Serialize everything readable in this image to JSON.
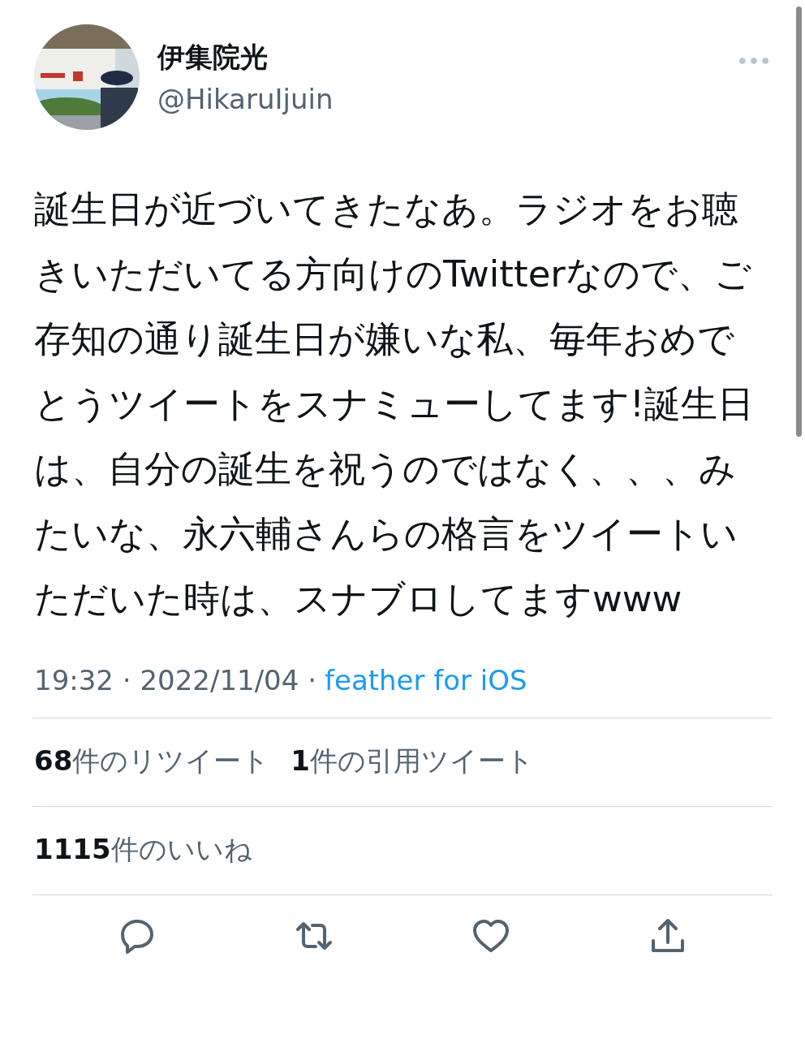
{
  "author": {
    "name": "伊集院光",
    "handle": "@HikaruIjuin"
  },
  "text": "誕生日が近づいてきたなあ。ラジオをお聴きいただいてる方向けのTwitterなので、ご存知の通り誕生日が嫌いな私、毎年おめでとうツイートをスナミューしてます!誕生日は、自分の誕生を祝うのではなく、、、みたいな、永六輔さんらの格言をツイートいただいた時は、スナブロしてますwww",
  "meta": {
    "time": "19:32",
    "separator": "·",
    "date": "2022/11/04",
    "source": "feather for iOS"
  },
  "stats": [
    {
      "count": "68",
      "label": "件のリツイート"
    },
    {
      "count": "1",
      "label": "件の引用ツイート"
    }
  ],
  "likes": {
    "count": "1115",
    "label": "件のいいね"
  },
  "actions": [
    {
      "kind": "reply"
    },
    {
      "kind": "retweet"
    },
    {
      "kind": "like"
    },
    {
      "kind": "share"
    }
  ]
}
